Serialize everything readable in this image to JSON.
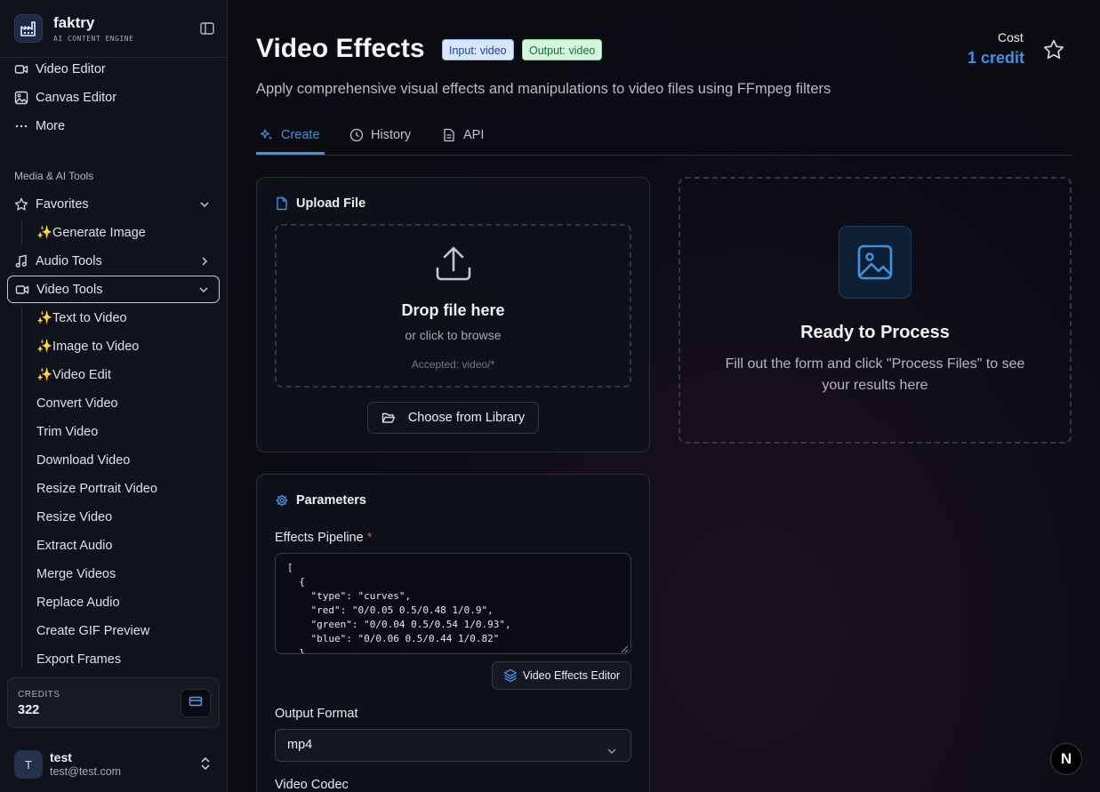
{
  "brand": {
    "name": "faktry",
    "tagline": "AI CONTENT ENGINE"
  },
  "sidebar": {
    "top_items": [
      {
        "label": "Video Editor",
        "icon": "video-editor-icon"
      },
      {
        "label": "Canvas Editor",
        "icon": "image-icon"
      },
      {
        "label": "More",
        "icon": "ellipsis-icon"
      }
    ],
    "section_label": "Media & AI Tools",
    "favorites": {
      "label": "Favorites",
      "items": [
        "✨Generate Image"
      ]
    },
    "audio_tools": {
      "label": "Audio Tools"
    },
    "video_tools": {
      "label": "Video Tools",
      "items": [
        "✨Text to Video",
        "✨Image to Video",
        "✨Video Edit",
        "Convert Video",
        "Trim Video",
        "Download Video",
        "Resize Portrait Video",
        "Resize Video",
        "Extract Audio",
        "Merge Videos",
        "Replace Audio",
        "Create GIF Preview",
        "Export Frames"
      ]
    },
    "credits": {
      "label": "CREDITS",
      "value": "322"
    },
    "user": {
      "initial": "T",
      "name": "test",
      "email": "test@test.com"
    }
  },
  "header": {
    "title": "Video Effects",
    "badge_input": "Input: video",
    "badge_output": "Output: video",
    "cost_label": "Cost",
    "cost_value": "1 credit",
    "subtitle": "Apply comprehensive visual effects and manipulations to video files using FFmpeg filters"
  },
  "tabs": [
    {
      "label": "Create",
      "active": true
    },
    {
      "label": "History"
    },
    {
      "label": "API"
    }
  ],
  "upload": {
    "title": "Upload File",
    "drop_title": "Drop file here",
    "drop_sub": "or click to browse",
    "accepted": "Accepted: video/*",
    "library_button": "Choose from Library"
  },
  "result": {
    "title": "Ready to Process",
    "text": "Fill out the form and click \"Process Files\" to see your results here"
  },
  "parameters": {
    "title": "Parameters",
    "pipeline_label": "Effects Pipeline",
    "required_mark": "*",
    "pipeline_value": "[\n  {\n    \"type\": \"curves\",\n    \"red\": \"0/0.05 0.5/0.48 1/0.9\",\n    \"green\": \"0/0.04 0.5/0.54 1/0.93\",\n    \"blue\": \"0/0.06 0.5/0.44 1/0.82\"\n  },",
    "fx_editor_button": "Video Effects Editor",
    "output_format_label": "Output Format",
    "output_format_value": "mp4",
    "video_codec_label": "Video Codec"
  },
  "floating_badge": "N",
  "colors": {
    "accent": "#3f93df",
    "required": "#e5484d"
  }
}
